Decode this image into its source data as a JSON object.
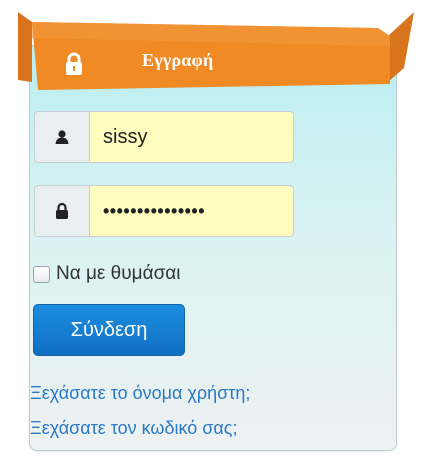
{
  "header": {
    "title": "Εγγραφή",
    "accent": "#f08a24"
  },
  "form": {
    "username": {
      "value": "sissy",
      "icon": "user-icon"
    },
    "password": {
      "value": "•••••••••••••••",
      "icon": "lock-icon"
    },
    "remember_label": "Να με θυμάσαι",
    "login_button": "Σύνδεση"
  },
  "links": {
    "forgot_username": "Ξεχάσατε το όνομα χρήστη;",
    "forgot_password": "Ξεχάσατε τον κωδικό σας;"
  },
  "colors": {
    "panel_top": "#b9eef0",
    "input_bg": "#fffcc0",
    "button": "#1573c9",
    "link": "#2a79c4"
  }
}
